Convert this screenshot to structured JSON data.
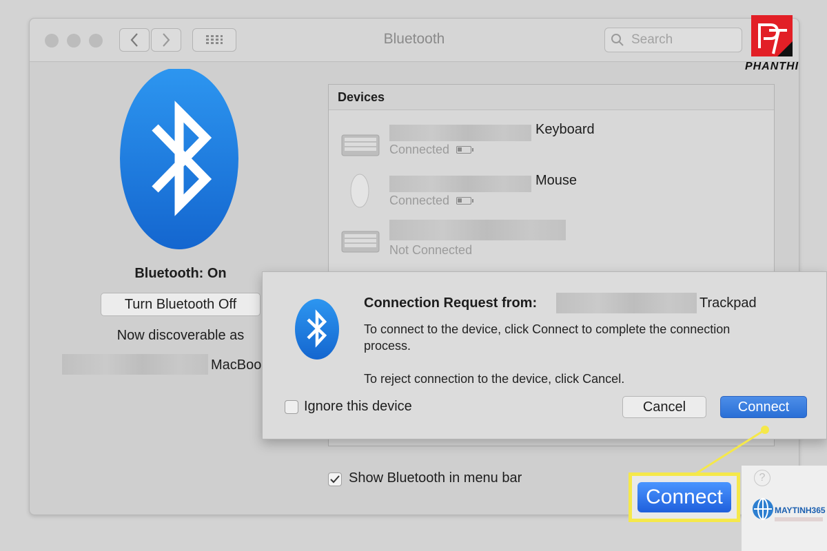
{
  "window": {
    "title": "Bluetooth"
  },
  "toolbar": {
    "back_icon": "chevron-left-icon",
    "forward_icon": "chevron-right-icon",
    "grid_icon": "grid-icon",
    "search_placeholder": "Search"
  },
  "logos": {
    "top_right_text": "PHANTHI",
    "bottom_right_text": "MAYTINH365"
  },
  "bluetooth_panel": {
    "status": "Bluetooth: On",
    "toggle_button": "Turn Bluetooth Off",
    "discoverable_label": "Now discoverable as",
    "computer_name_suffix": "MacBook"
  },
  "devices": {
    "header": "Devices",
    "items": [
      {
        "name_suffix": "Keyboard",
        "status": "Connected",
        "icon": "keyboard-icon",
        "battery": true
      },
      {
        "name_suffix": "Mouse",
        "status": "Connected",
        "icon": "mouse-icon",
        "battery": true
      },
      {
        "name_suffix": "",
        "status": "Not Connected",
        "icon": "keyboard-icon",
        "battery": false
      }
    ]
  },
  "dialog": {
    "title": "Connection Request from:",
    "device_suffix": "Trackpad",
    "line1": "To connect to the device, click Connect to complete the connection process.",
    "line2": "To reject connection to the device, click Cancel.",
    "ignore_label": "Ignore this device",
    "cancel_label": "Cancel",
    "connect_label": "Connect"
  },
  "footer": {
    "show_in_menu_bar_label": "Show Bluetooth in menu bar",
    "show_in_menu_bar_checked": true,
    "callout_label": "Connect"
  },
  "colors": {
    "bluetooth_blue": "#1a76e0",
    "highlight_yellow": "#f5e84a",
    "connect_blue": "#2a6fd6"
  }
}
